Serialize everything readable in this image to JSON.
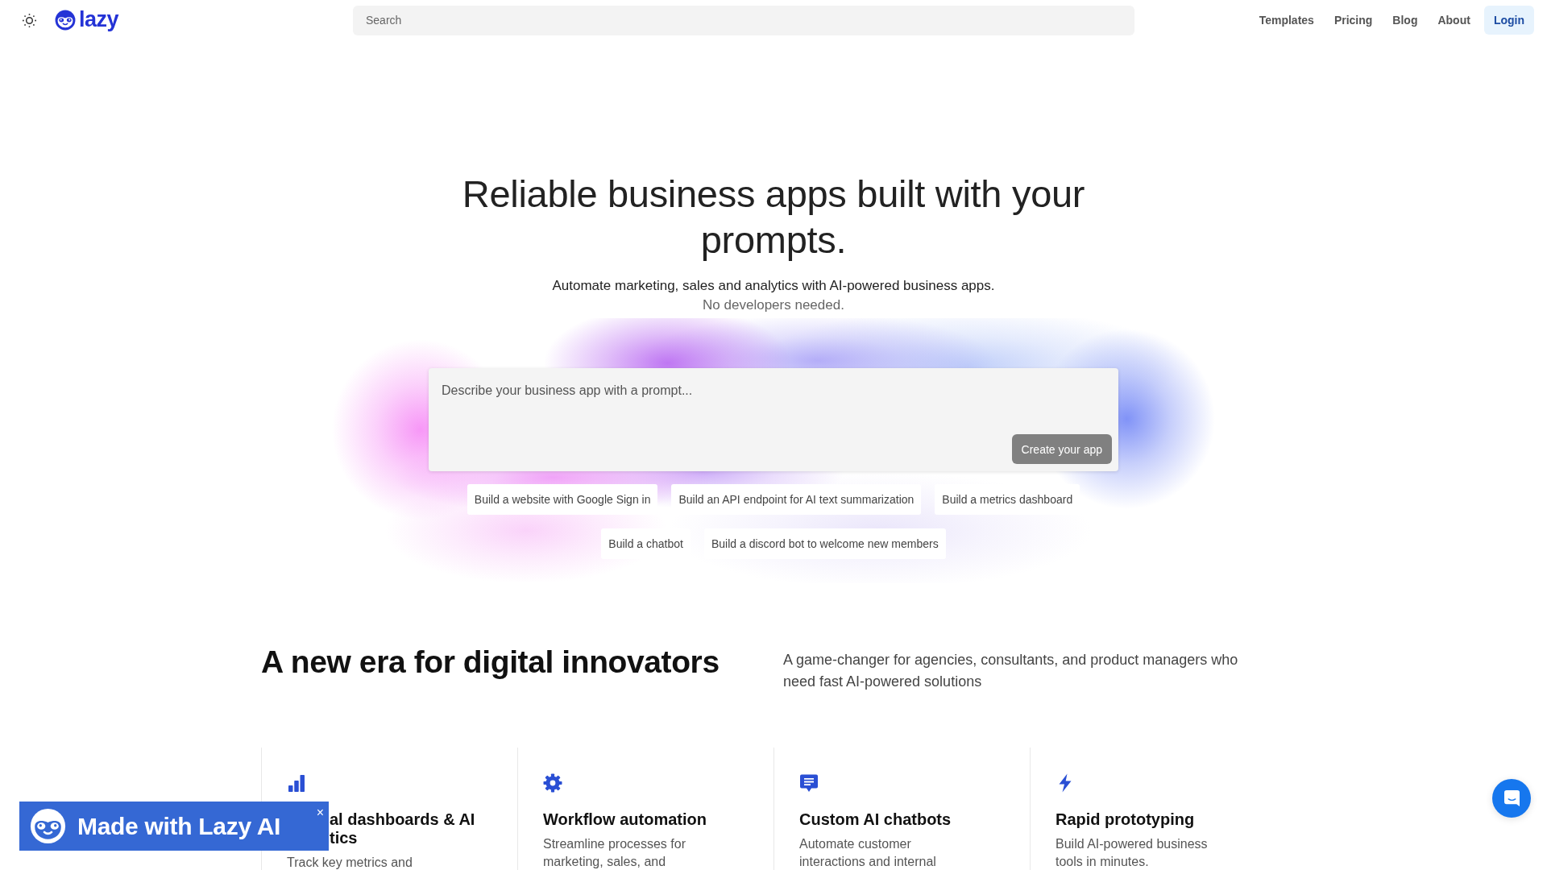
{
  "header": {
    "logo": "lazy",
    "search": {
      "placeholder": "Search"
    },
    "nav": [
      {
        "label": "Templates"
      },
      {
        "label": "Pricing"
      },
      {
        "label": "Blog"
      },
      {
        "label": "About"
      }
    ],
    "login": "Login"
  },
  "hero": {
    "title": "Reliable business apps built with your prompts.",
    "subtitle": "Automate marketing, sales and analytics with AI-powered business apps.",
    "note": "No developers needed.",
    "prompt": {
      "placeholder": "Describe your business app with a prompt...",
      "button": "Create your app"
    },
    "suggestions": [
      "Build a website with Google Sign in",
      "Build an API endpoint for AI text summarization",
      "Build a metrics dashboard",
      "Build a chatbot",
      "Build a discord bot to welcome new members"
    ]
  },
  "intro": {
    "heading": "A new era for digital innovators",
    "text": "A game-changer for agencies, consultants, and product managers who need fast AI-powered solutions"
  },
  "features": [
    {
      "title_lines": [
        "al dashboards & AI",
        "tics"
      ],
      "description_lines": [
        "Track key metrics and"
      ]
    },
    {
      "title_lines": [
        "Workflow automation"
      ],
      "description_lines": [
        "Streamline processes for",
        "marketing, sales, and"
      ]
    },
    {
      "title_lines": [
        "Custom AI chatbots"
      ],
      "description_lines": [
        "Automate customer",
        "interactions and internal"
      ]
    },
    {
      "title_lines": [
        "Rapid prototyping"
      ],
      "description_lines": [
        "Build AI-powered business",
        "tools in minutes."
      ]
    }
  ],
  "badge": {
    "text": "Made with Lazy AI",
    "close": "×"
  }
}
